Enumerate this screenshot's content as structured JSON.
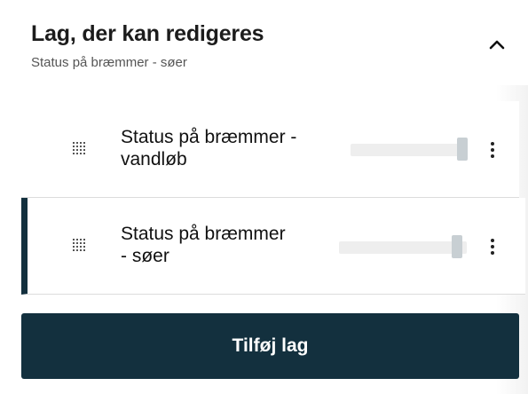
{
  "header": {
    "title": "Lag, der kan redigeres",
    "subtitle": "Status på bræmmer - søer",
    "collapse_icon": "chevron-up-icon"
  },
  "layers": [
    {
      "name_line1": "Status på bræmmer -",
      "name_line2": "vandløb",
      "opacity": 1.0,
      "active": false,
      "drag_icon": "drag-handle-icon",
      "menu_icon": "more-vertical-icon"
    },
    {
      "name_line1": "Status på bræmmer",
      "name_line2": "- søer",
      "opacity": 1.0,
      "active": true,
      "drag_icon": "drag-handle-icon",
      "menu_icon": "more-vertical-icon"
    }
  ],
  "actions": {
    "add_layer_label": "Tilføj lag"
  },
  "colors": {
    "accent": "#13303e",
    "slider_track": "#eeeeee",
    "slider_thumb": "#c8cfd3"
  }
}
